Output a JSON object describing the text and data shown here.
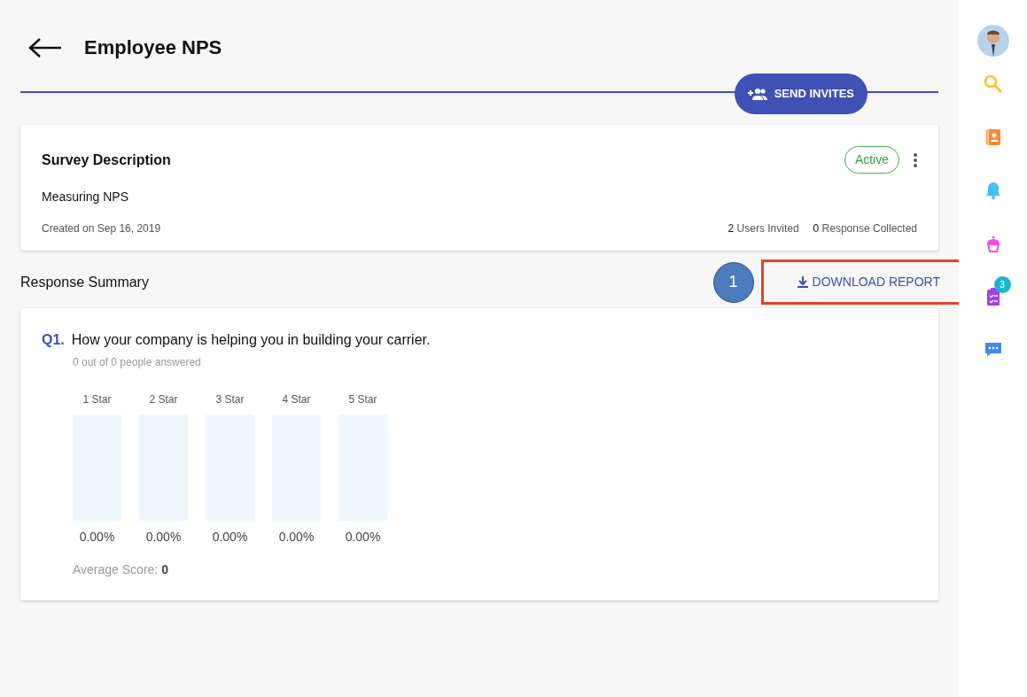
{
  "header": {
    "title": "Employee NPS",
    "send_invites_button": "SEND INVITES"
  },
  "survey": {
    "heading": "Survey Description",
    "status": "Active",
    "description": "Measuring NPS",
    "created": "Created on Sep 16, 2019",
    "stats": [
      {
        "count": "2",
        "label": "Users Invited"
      },
      {
        "count": "0",
        "label": "Response Collected"
      }
    ]
  },
  "response_summary": {
    "heading": "Response Summary",
    "annotation_marker": "1",
    "download_button": "DOWNLOAD REPORT",
    "highlighted": true,
    "questions": [
      {
        "number": "Q1.",
        "text": "How your company is helping you in building your carrier.",
        "answered": "0 out of 0 people answered",
        "ratings": [
          {
            "label": "1 Star",
            "level": 0,
            "percent": "0.00%"
          },
          {
            "label": "2 Star",
            "level": 0,
            "percent": "0.00%"
          },
          {
            "label": "3 Star",
            "level": 0,
            "percent": "0.00%"
          },
          {
            "label": "4 Star",
            "level": 0,
            "percent": "0.00%"
          },
          {
            "label": "5 Star",
            "level": 0,
            "percent": "0.00%"
          }
        ],
        "average_label": "Average Score:",
        "average_value": "0"
      }
    ]
  },
  "sidebar": {
    "items": [
      {
        "kind": "avatar"
      },
      {
        "kind": "search"
      },
      {
        "kind": "contacts"
      },
      {
        "kind": "bell"
      },
      {
        "kind": "cake"
      },
      {
        "kind": "tasks",
        "badge": "3"
      },
      {
        "kind": "chat"
      }
    ]
  }
}
